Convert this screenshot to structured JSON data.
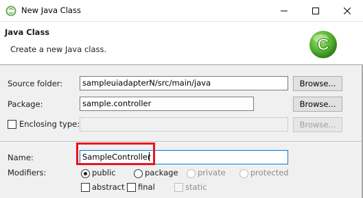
{
  "window": {
    "title": "New Java Class",
    "minimize_icon": "minimize-icon",
    "maximize_icon": "maximize-icon",
    "close_icon": "close-icon"
  },
  "banner": {
    "title": "Java Class",
    "subtitle": "Create a new Java class.",
    "logo_letter": "C",
    "logo_color": "#56b531"
  },
  "form": {
    "source_folder": {
      "label": "Source folder:",
      "value": "sampleuiadapterN/src/main/java",
      "button": "Browse..."
    },
    "package": {
      "label": "Package:",
      "value": "sample.controller",
      "button": "Browse..."
    },
    "enclosing_type": {
      "label": "Enclosing type:",
      "checked": false,
      "value": "",
      "button": "Browse..."
    },
    "name": {
      "label": "Name:",
      "value": "SampleController"
    },
    "modifiers": {
      "label": "Modifiers:",
      "radios": [
        {
          "label": "public",
          "checked": true,
          "enabled": true
        },
        {
          "label": "package",
          "checked": false,
          "enabled": true
        },
        {
          "label": "private",
          "checked": false,
          "enabled": false
        },
        {
          "label": "protected",
          "checked": false,
          "enabled": false
        }
      ],
      "checkboxes": [
        {
          "label": "abstract",
          "checked": false,
          "enabled": true
        },
        {
          "label": "final",
          "checked": false,
          "enabled": true
        },
        {
          "label": "static",
          "checked": false,
          "enabled": false
        }
      ]
    }
  },
  "colors": {
    "highlight": "#e8131f",
    "focus": "#0078d7"
  }
}
